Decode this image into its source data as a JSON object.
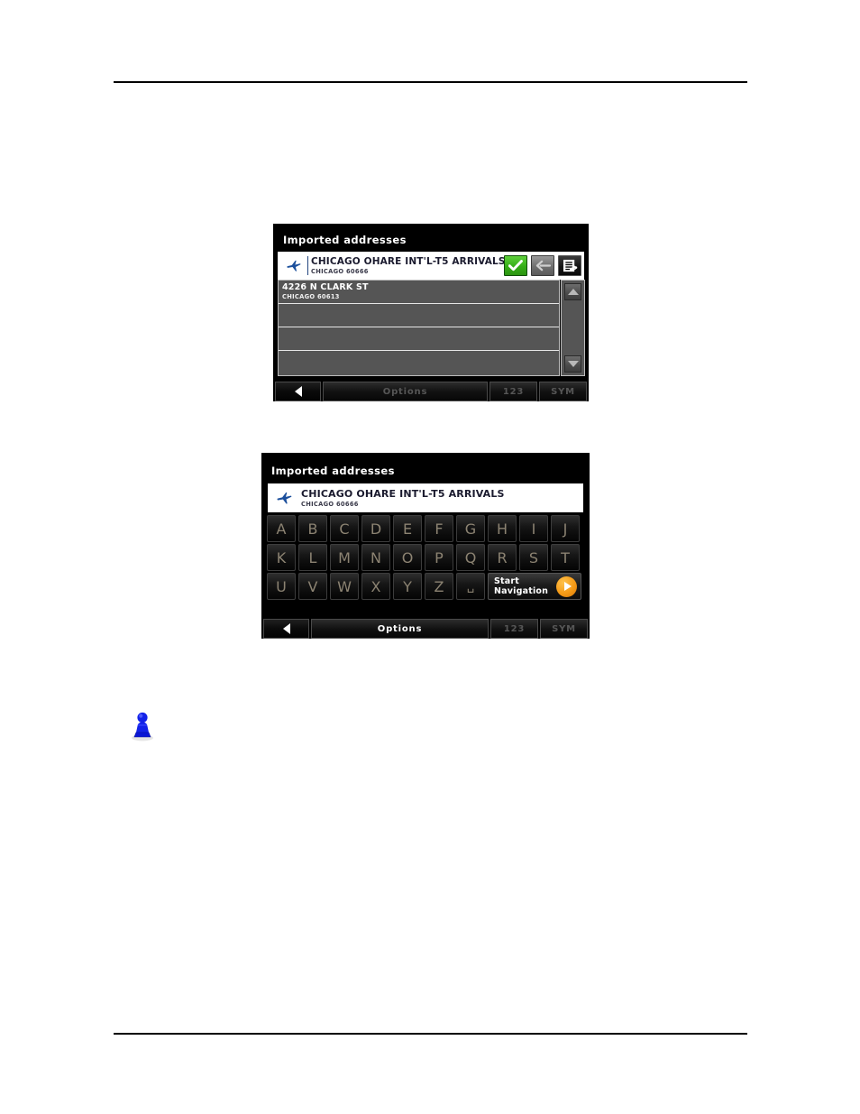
{
  "page": {
    "background_color": "#ffffff",
    "rule_color": "#000000"
  },
  "panel_one": {
    "title": "Imported addresses",
    "entry": {
      "icon": "airplane-icon",
      "name": "CHICAGO OHARE INT'L-T5 ARRIVALS",
      "subtitle": "CHICAGO 60666",
      "has_text_cursor": true
    },
    "actions": [
      {
        "name": "confirm-button",
        "icon": "checkmark-icon",
        "color": "#35ad16"
      },
      {
        "name": "back-button",
        "icon": "arrow-left-icon",
        "color": "#6f6f6f"
      },
      {
        "name": "list-button",
        "icon": "list-export-icon",
        "color": "#141414"
      }
    ],
    "list": [
      {
        "title": "4226 N CLARK ST",
        "subtitle": "CHICAGO 60613",
        "selected": true
      },
      {
        "title": "",
        "subtitle": "",
        "selected": false
      },
      {
        "title": "",
        "subtitle": "",
        "selected": false
      },
      {
        "title": "",
        "subtitle": "",
        "selected": false
      }
    ],
    "scroll": {
      "up_icon": "triangle-up-icon",
      "down_icon": "triangle-down-icon"
    },
    "toolbar": {
      "back_icon": "triangle-left-icon",
      "options_label": "Options",
      "numeric_label": "123",
      "symbol_label": "SYM"
    }
  },
  "panel_two": {
    "title": "Imported addresses",
    "entry": {
      "icon": "airplane-icon",
      "name": "CHICAGO OHARE INT'L-T5 ARRIVALS",
      "subtitle": "CHICAGO 60666"
    },
    "keyboard": {
      "row1": [
        "A",
        "B",
        "C",
        "D",
        "E",
        "F",
        "G",
        "H",
        "I",
        "J"
      ],
      "row2": [
        "K",
        "L",
        "M",
        "N",
        "O",
        "P",
        "Q",
        "R",
        "S",
        "T"
      ],
      "row3": [
        "U",
        "V",
        "W",
        "X",
        "Y",
        "Z"
      ],
      "space_label": "␣"
    },
    "start_navigation": {
      "line1": "Start",
      "line2": "Navigation",
      "icon": "arrow-right-circle-icon",
      "accent_color": "#f59a16"
    },
    "toolbar": {
      "back_icon": "triangle-left-icon",
      "options_label": "Options",
      "numeric_label": "123",
      "symbol_label": "SYM"
    }
  },
  "info_icon": {
    "name": "info-pawn-icon",
    "color": "#0a16d6"
  }
}
